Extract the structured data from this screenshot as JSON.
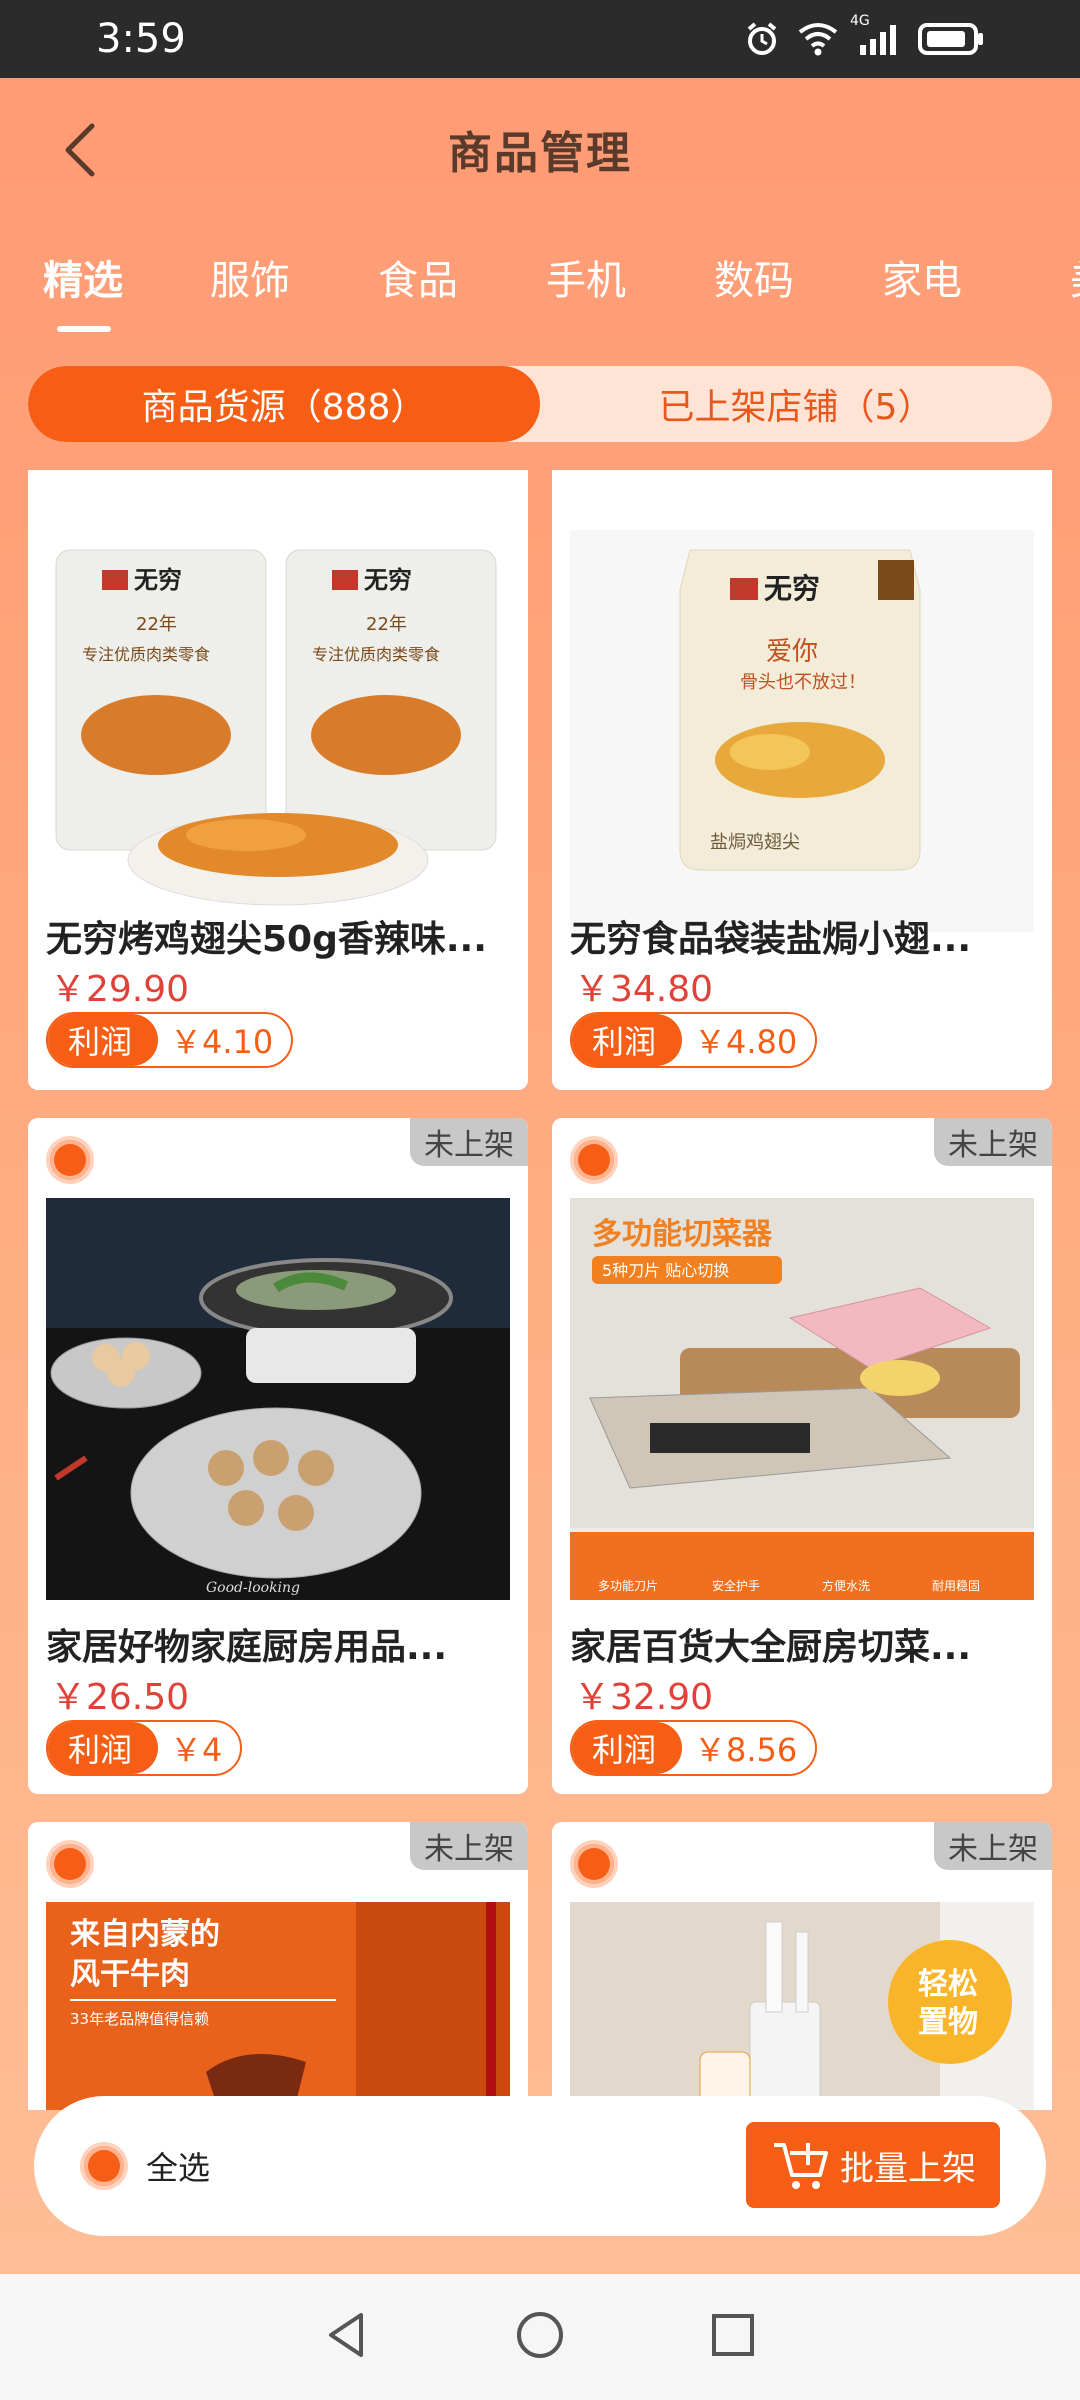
{
  "status_bar": {
    "time": "3:59",
    "network": "4G"
  },
  "header": {
    "title": "商品管理"
  },
  "categories": [
    {
      "label": "精选",
      "active": true
    },
    {
      "label": "服饰"
    },
    {
      "label": "食品"
    },
    {
      "label": "手机"
    },
    {
      "label": "数码"
    },
    {
      "label": "家电"
    },
    {
      "label": "美"
    }
  ],
  "segments": [
    {
      "label": "商品货源（888）",
      "active": true
    },
    {
      "label": "已上架店铺（5）"
    }
  ],
  "products": [
    {
      "name": "无穷烤鸡翅尖50g香辣味...",
      "price": "￥29.90",
      "profit_label": "利润",
      "profit": "￥4.10",
      "status": ""
    },
    {
      "name": "无穷食品袋装盐焗小翅...",
      "price": "￥34.80",
      "profit_label": "利润",
      "profit": "￥4.80",
      "status": ""
    },
    {
      "name": "家居好物家庭厨房用品...",
      "price": "￥26.50",
      "profit_label": "利润",
      "profit": "￥4",
      "status": "未上架"
    },
    {
      "name": "家居百货大全厨房切菜...",
      "price": "￥32.90",
      "profit_label": "利润",
      "profit": "￥8.56",
      "status": "未上架"
    },
    {
      "name": "",
      "price": "",
      "profit_label": "",
      "profit": "",
      "status": "未上架"
    },
    {
      "name": "",
      "price": "",
      "profit_label": "",
      "profit": "",
      "status": "未上架"
    }
  ],
  "product_image_text": {
    "brand": "无穷",
    "years": "22年",
    "tagline": "专注优质肉类零食",
    "love": "爱你",
    "love_sub": "骨头也不放过！",
    "salted": "盐焗鸡翅尖",
    "good_looking": "Good-looking",
    "slicer_title": "多功能切菜器",
    "slicer_sub": "5种刀片 贴心切换",
    "slicer_features": [
      "多功能刀片",
      "安全护手",
      "方便水洗",
      "耐用稳固"
    ],
    "beef_title1": "来自内蒙的",
    "beef_title2": "风干牛肉",
    "beef_sub": "33年老品牌值得信赖",
    "storage1": "轻松",
    "storage2": "置物"
  },
  "bottom_bar": {
    "select_all": "全选",
    "batch_button": "批量上架"
  },
  "colors": {
    "accent": "#f65e16",
    "price": "#e0423a",
    "badge_gray": "#c8c8c8"
  }
}
